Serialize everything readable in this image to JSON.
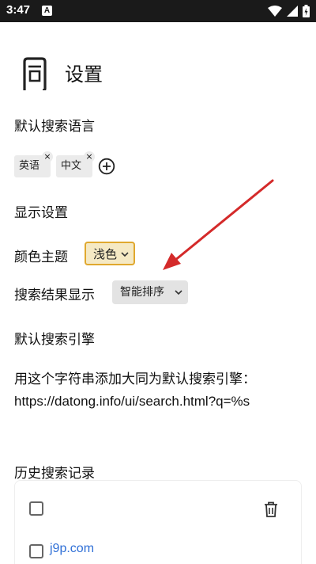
{
  "status_bar": {
    "time": "3:47",
    "notification_letter": "A"
  },
  "header": {
    "title": "设置"
  },
  "language_section": {
    "title": "默认搜索语言",
    "chips": [
      {
        "label": "英语",
        "close": "×"
      },
      {
        "label": "中文",
        "close": "×"
      }
    ]
  },
  "display_section": {
    "title": "显示设置",
    "theme": {
      "label": "颜色主题",
      "value": "浅色"
    },
    "results": {
      "label": "搜索结果显示",
      "value": "智能排序"
    }
  },
  "engine_section": {
    "title": "默认搜索引擎",
    "instruction": "用这个字符串添加大同为默认搜索引擎：",
    "url": "https://datong.info/ui/search.html?q=%s"
  },
  "history_section": {
    "title": "历史搜索记录",
    "items": [
      {
        "text": "j9p.com"
      }
    ]
  },
  "colors": {
    "accent_arrow": "#d42a2a",
    "theme_select_bg": "#f5e9c4",
    "theme_select_border": "#e0a82e",
    "link": "#2f6fd6"
  }
}
